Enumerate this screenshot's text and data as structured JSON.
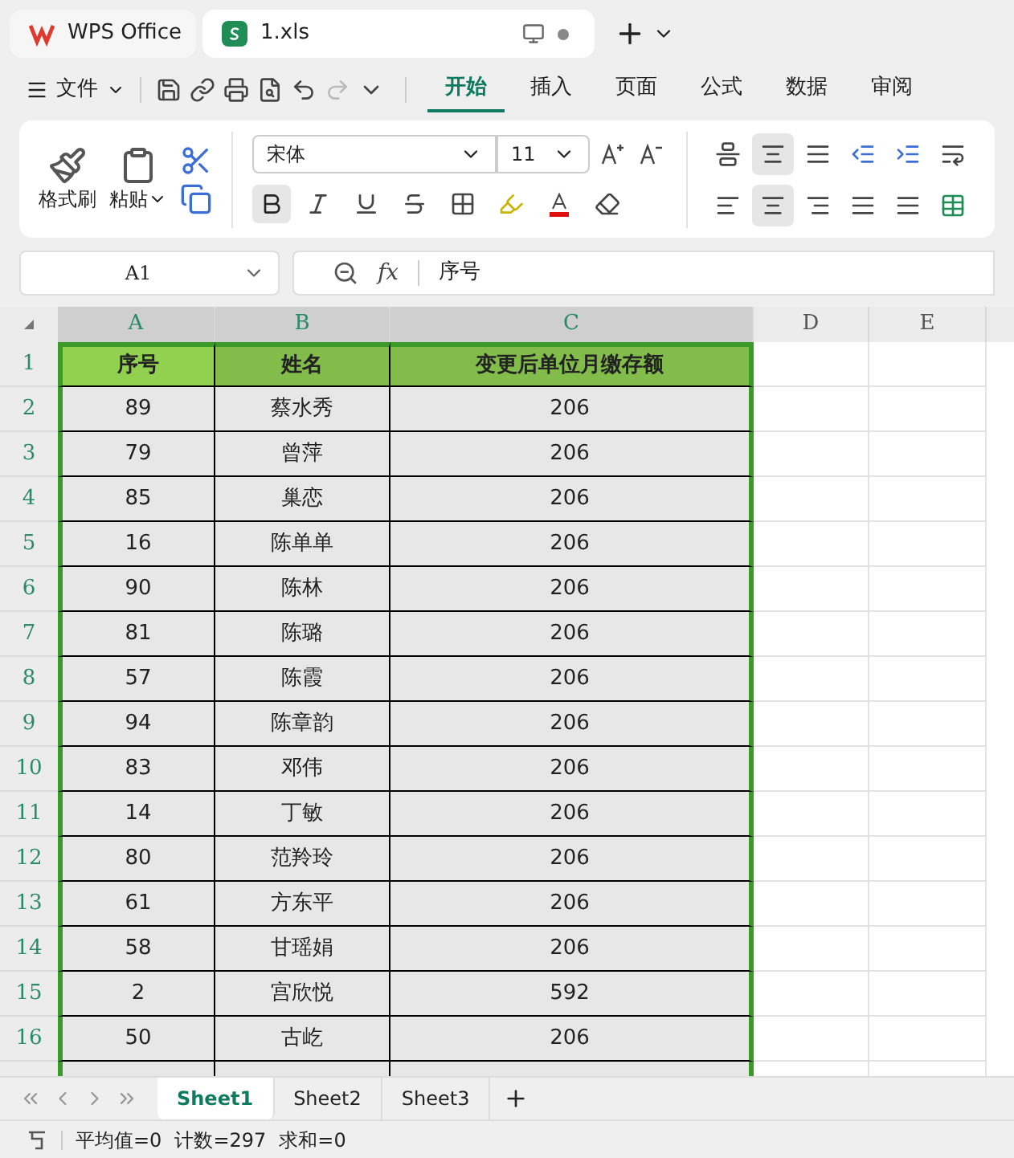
{
  "title_tabs": [
    {
      "label": "WPS Office",
      "kind": "home",
      "selected": false
    },
    {
      "label": "1.xls",
      "kind": "sheet",
      "selected": true
    }
  ],
  "menu": {
    "file": "文件",
    "tabs": [
      {
        "label": "开始",
        "selected": true
      },
      {
        "label": "插入",
        "selected": false
      },
      {
        "label": "页面",
        "selected": false
      },
      {
        "label": "公式",
        "selected": false
      },
      {
        "label": "数据",
        "selected": false
      },
      {
        "label": "审阅",
        "selected": false
      }
    ]
  },
  "ribbon": {
    "format_painter": "格式刷",
    "paste": "粘贴",
    "font": "宋体",
    "size": "11",
    "bold": true
  },
  "formula_bar": {
    "name_box": "A1",
    "fx": "fx",
    "formula": "序号"
  },
  "columns": [
    {
      "label": "A",
      "selected": true
    },
    {
      "label": "B",
      "selected": true
    },
    {
      "label": "C",
      "selected": true
    },
    {
      "label": "D",
      "selected": false
    },
    {
      "label": "E",
      "selected": false
    }
  ],
  "header_row": {
    "number": "1",
    "cells": [
      "序号",
      "姓名",
      "变更后单位月缴存额"
    ]
  },
  "rows": [
    {
      "number": "2",
      "cells": [
        "89",
        "蔡水秀",
        "206"
      ]
    },
    {
      "number": "3",
      "cells": [
        "79",
        "曾萍",
        "206"
      ]
    },
    {
      "number": "4",
      "cells": [
        "85",
        "巢恋",
        "206"
      ]
    },
    {
      "number": "5",
      "cells": [
        "16",
        "陈单单",
        "206"
      ]
    },
    {
      "number": "6",
      "cells": [
        "90",
        "陈林",
        "206"
      ]
    },
    {
      "number": "7",
      "cells": [
        "81",
        "陈璐",
        "206"
      ]
    },
    {
      "number": "8",
      "cells": [
        "57",
        "陈霞",
        "206"
      ]
    },
    {
      "number": "9",
      "cells": [
        "94",
        "陈章韵",
        "206"
      ]
    },
    {
      "number": "10",
      "cells": [
        "83",
        "邓伟",
        "206"
      ]
    },
    {
      "number": "11",
      "cells": [
        "14",
        "丁敏",
        "206"
      ]
    },
    {
      "number": "12",
      "cells": [
        "80",
        "范羚玲",
        "206"
      ]
    },
    {
      "number": "13",
      "cells": [
        "61",
        "方东平",
        "206"
      ]
    },
    {
      "number": "14",
      "cells": [
        "58",
        "甘瑶娟",
        "206"
      ]
    },
    {
      "number": "15",
      "cells": [
        "2",
        "宫欣悦",
        "592"
      ]
    },
    {
      "number": "16",
      "cells": [
        "50",
        "古屹",
        "206"
      ]
    }
  ],
  "sheets": [
    {
      "label": "Sheet1",
      "selected": true
    },
    {
      "label": "Sheet2",
      "selected": false
    },
    {
      "label": "Sheet3",
      "selected": false
    }
  ],
  "status_bar": [
    "平均值=0",
    "计数=297",
    "求和=0"
  ]
}
